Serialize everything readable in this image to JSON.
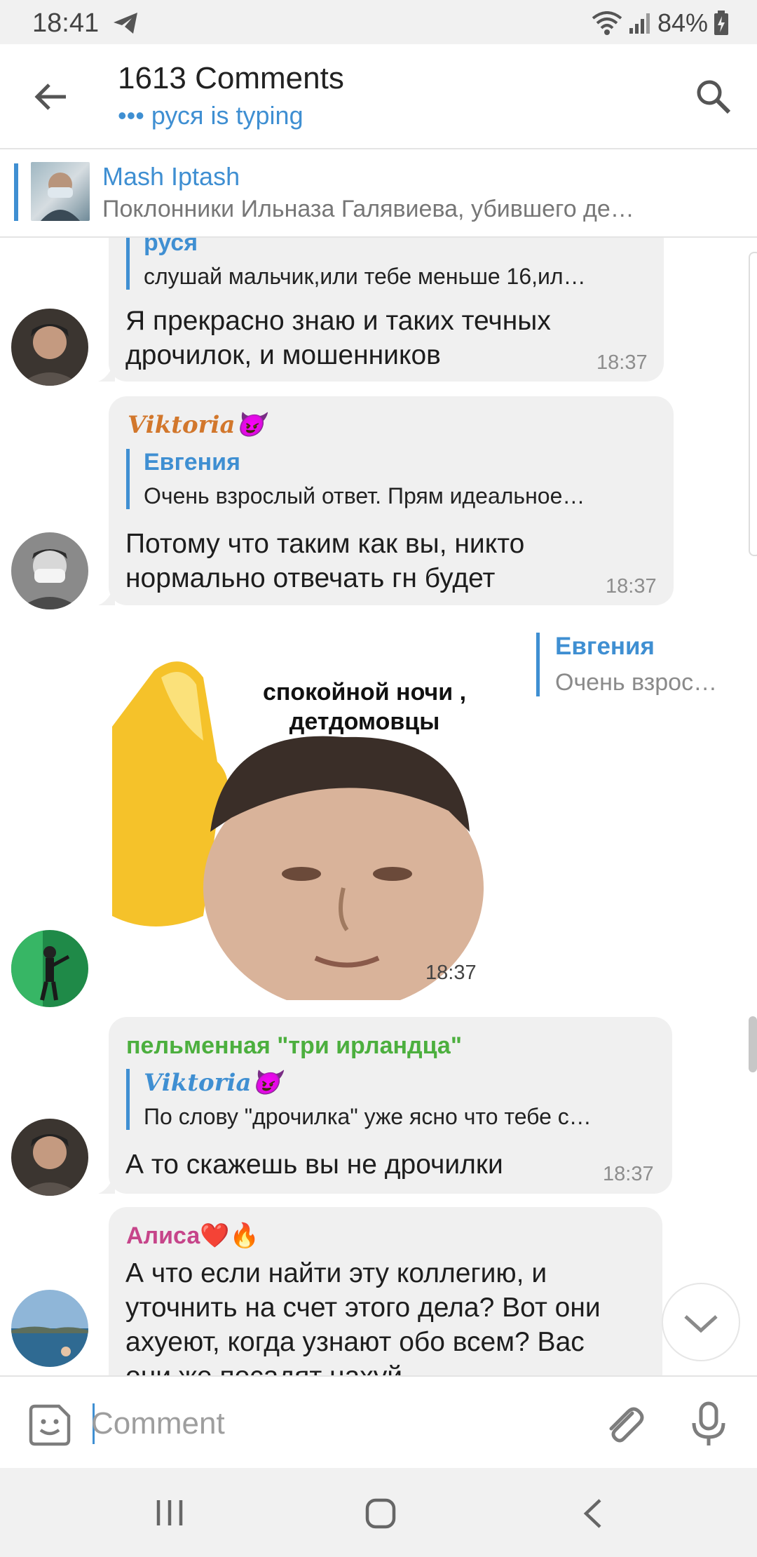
{
  "status_bar": {
    "time": "18:41",
    "battery": "84%"
  },
  "header": {
    "title": "1613 Comments",
    "typing": "••• руся is typing"
  },
  "pinned": {
    "name": "Mash Iptash",
    "text": "Поклонники Ильназа Галявиева, убившего де…"
  },
  "messages": [
    {
      "reply_name": "руся",
      "reply_text": "слушай мальчик,или тебе меньше 16,ил…",
      "text1": "Я прекрасно знаю и таких течных",
      "text2": "дрочилок, и мошенников",
      "time": "18:37"
    },
    {
      "sender": "Viktoria😈",
      "reply_name": "Евгения",
      "reply_text": "Очень взрослый ответ. Прям идеальное…",
      "text1": "Потому что таким как вы, никто",
      "text2": "нормально отвечать гн будет",
      "time": "18:37"
    },
    {
      "sticker_caption1": "спокойной ночи ,",
      "sticker_caption2": "детдомовцы",
      "reply_name": "Евгения",
      "reply_text": "Очень взрос…",
      "time": "18:37"
    },
    {
      "sender": "пельменная \"три ирландца\"",
      "reply_name": "Viktoria😈",
      "reply_text": "По слову \"дрочилка\" уже ясно что тебе с…",
      "text1": "А то скажешь вы не дрочилки",
      "time": "18:37"
    },
    {
      "sender": "Алиса❤️🔥",
      "text1": "А что если найти эту коллегию, и",
      "text2": "уточнить на счет этого дела? Вот они",
      "text3": "ахуеют, когда узнают обо всем? Вас",
      "text4": "они же посадят нахуй"
    }
  ],
  "input": {
    "placeholder": "Comment"
  },
  "colors": {
    "accent": "#3f8fd2",
    "green_name": "#4caf3e",
    "pink_name": "#c6458a",
    "bubble": "#f0f0f0"
  }
}
